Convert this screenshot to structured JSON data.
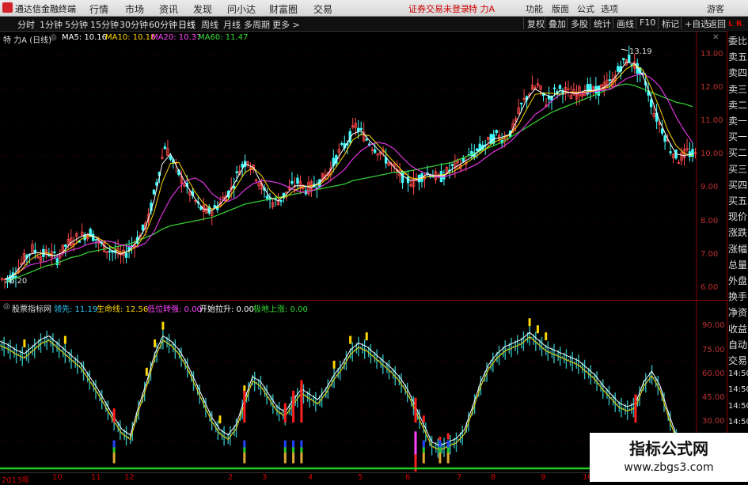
{
  "titlebar": {
    "app_title": "通达信金融终端",
    "menus": [
      "行情",
      "市场",
      "资讯",
      "发现",
      "问小达",
      "财富圈",
      "交易"
    ],
    "warning": "证券交易未登录",
    "stock_name": "特 力A",
    "right_items": [
      "功能",
      "版面",
      "公式",
      "选项"
    ],
    "guest": "游客"
  },
  "toolbar": {
    "periods": [
      "分时",
      "1分钟",
      "5分钟",
      "15分钟",
      "30分钟",
      "60分钟",
      "日线",
      "周线",
      "月线",
      "多周期",
      "更多 >"
    ],
    "active_period": "日线",
    "right_buttons": [
      "复权",
      "叠加",
      "多股",
      "统计",
      "画线",
      "F10",
      "标记",
      "+自选",
      "返回"
    ]
  },
  "main_chart": {
    "header_name": "特 力A (日线)",
    "ma": [
      {
        "label": "MA5: 10.16",
        "color": "#ffffff"
      },
      {
        "label": "MA10: 10.18",
        "color": "#ffd700"
      },
      {
        "label": "MA20: 10.37",
        "color": "#ff44ff"
      },
      {
        "label": "MA60: 11.47",
        "color": "#33dd33"
      }
    ],
    "high_label": "13.19",
    "low_label": "6.20",
    "y_ticks": [
      "13.00",
      "12.00",
      "11.00",
      "10.00",
      "9.00",
      "8.00",
      "7.00",
      "6.00"
    ]
  },
  "sub_chart": {
    "header_name": "股票指标网",
    "items": [
      {
        "label": "领先: 11.19",
        "color": "#33ccff"
      },
      {
        "label": "生命线: 12.56",
        "color": "#ffd700"
      },
      {
        "label": "低位转强: 0.00",
        "color": "#ff44ff"
      },
      {
        "label": "开始拉升: 0.00",
        "color": "#ffffff"
      },
      {
        "label": "极地上涨: 0.00",
        "color": "#33dd33"
      }
    ],
    "y_ticks": [
      "90.00",
      "75.00",
      "60.00",
      "45.00",
      "30.00"
    ]
  },
  "right_panel": {
    "label_r": "L R",
    "items": [
      "委比",
      "卖五",
      "卖四",
      "卖三",
      "卖二",
      "卖一",
      "买一",
      "买二",
      "买三",
      "买四",
      "买五",
      "现价",
      "涨跌",
      "涨幅",
      "总量",
      "外盘",
      "换手",
      "净资",
      "收益",
      "自动",
      "交易",
      "14:50",
      "14:50",
      "14:50",
      "14:50",
      "14:50",
      "14:50",
      "14:50"
    ]
  },
  "dates": {
    "items": [
      "2013年",
      "10",
      "11",
      "12",
      "2",
      "3",
      "4",
      "5",
      "6",
      "7",
      "8",
      "9",
      "10",
      "11"
    ]
  },
  "watermark": {
    "line1": "指标公式网",
    "line2": "www.zbgs3.com"
  },
  "chart_data": {
    "type": "candlestick",
    "main": {
      "ylim": [
        5.8,
        13.5
      ],
      "close": [
        6.3,
        6.5,
        6.9,
        7.2,
        7.0,
        7.1,
        6.9,
        7.3,
        7.5,
        7.6,
        7.7,
        7.4,
        7.2,
        7.1,
        7.0,
        7.3,
        7.6,
        8.1,
        9.2,
        10.3,
        9.8,
        9.3,
        8.9,
        8.5,
        8.3,
        8.4,
        8.7,
        9.0,
        9.6,
        9.9,
        9.4,
        8.9,
        8.6,
        8.7,
        9.0,
        9.2,
        9.0,
        9.1,
        9.3,
        9.6,
        10.1,
        10.4,
        10.9,
        10.6,
        10.3,
        10.1,
        9.8,
        9.5,
        9.3,
        9.2,
        9.4,
        9.5,
        9.3,
        9.5,
        9.7,
        9.8,
        10.0,
        10.2,
        10.4,
        10.6,
        10.5,
        10.8,
        11.5,
        11.9,
        12.1,
        11.6,
        11.9,
        12.0,
        11.8,
        11.9,
        12.0,
        11.9,
        12.1,
        12.2,
        12.7,
        12.9,
        12.6,
        12.2,
        11.3,
        10.8,
        10.2,
        9.9,
        10.1,
        10.0
      ],
      "ma60": [
        6.2,
        6.3,
        6.4,
        6.5,
        6.6,
        6.7,
        6.75,
        6.85,
        6.95,
        7.0,
        7.1,
        7.15,
        7.2,
        7.25,
        7.3,
        7.35,
        7.45,
        7.55,
        7.65,
        7.8,
        7.9,
        7.95,
        8.0,
        8.05,
        8.1,
        8.15,
        8.25,
        8.35,
        8.45,
        8.55,
        8.6,
        8.65,
        8.7,
        8.75,
        8.8,
        8.85,
        8.9,
        8.95,
        9.0,
        9.05,
        9.1,
        9.15,
        9.25,
        9.3,
        9.35,
        9.4,
        9.45,
        9.5,
        9.5,
        9.55,
        9.6,
        9.65,
        9.7,
        9.75,
        9.8,
        9.9,
        10.0,
        10.1,
        10.2,
        10.3,
        10.4,
        10.55,
        10.7,
        10.85,
        11.0,
        11.15,
        11.3,
        11.4,
        11.5,
        11.6,
        11.7,
        11.8,
        11.9,
        12.0,
        12.1,
        12.15,
        12.1,
        12.0,
        11.9,
        11.8,
        11.7,
        11.6,
        11.55,
        11.47
      ]
    },
    "sub": {
      "ylim": [
        15,
        100
      ],
      "line": [
        85,
        83,
        80,
        78,
        82,
        86,
        88,
        84,
        80,
        76,
        72,
        65,
        58,
        50,
        42,
        35,
        32,
        48,
        62,
        78,
        88,
        85,
        80,
        72,
        62,
        52,
        42,
        35,
        32,
        38,
        52,
        65,
        62,
        55,
        48,
        45,
        52,
        58,
        55,
        52,
        58,
        66,
        72,
        80,
        84,
        82,
        78,
        74,
        70,
        65,
        58,
        48,
        38,
        28,
        26,
        28,
        30,
        35,
        48,
        62,
        72,
        78,
        82,
        84,
        86,
        90,
        86,
        82,
        80,
        78,
        76,
        74,
        70,
        66,
        60,
        55,
        50,
        48,
        50,
        62,
        68,
        60,
        45,
        32,
        26,
        22
      ]
    }
  }
}
